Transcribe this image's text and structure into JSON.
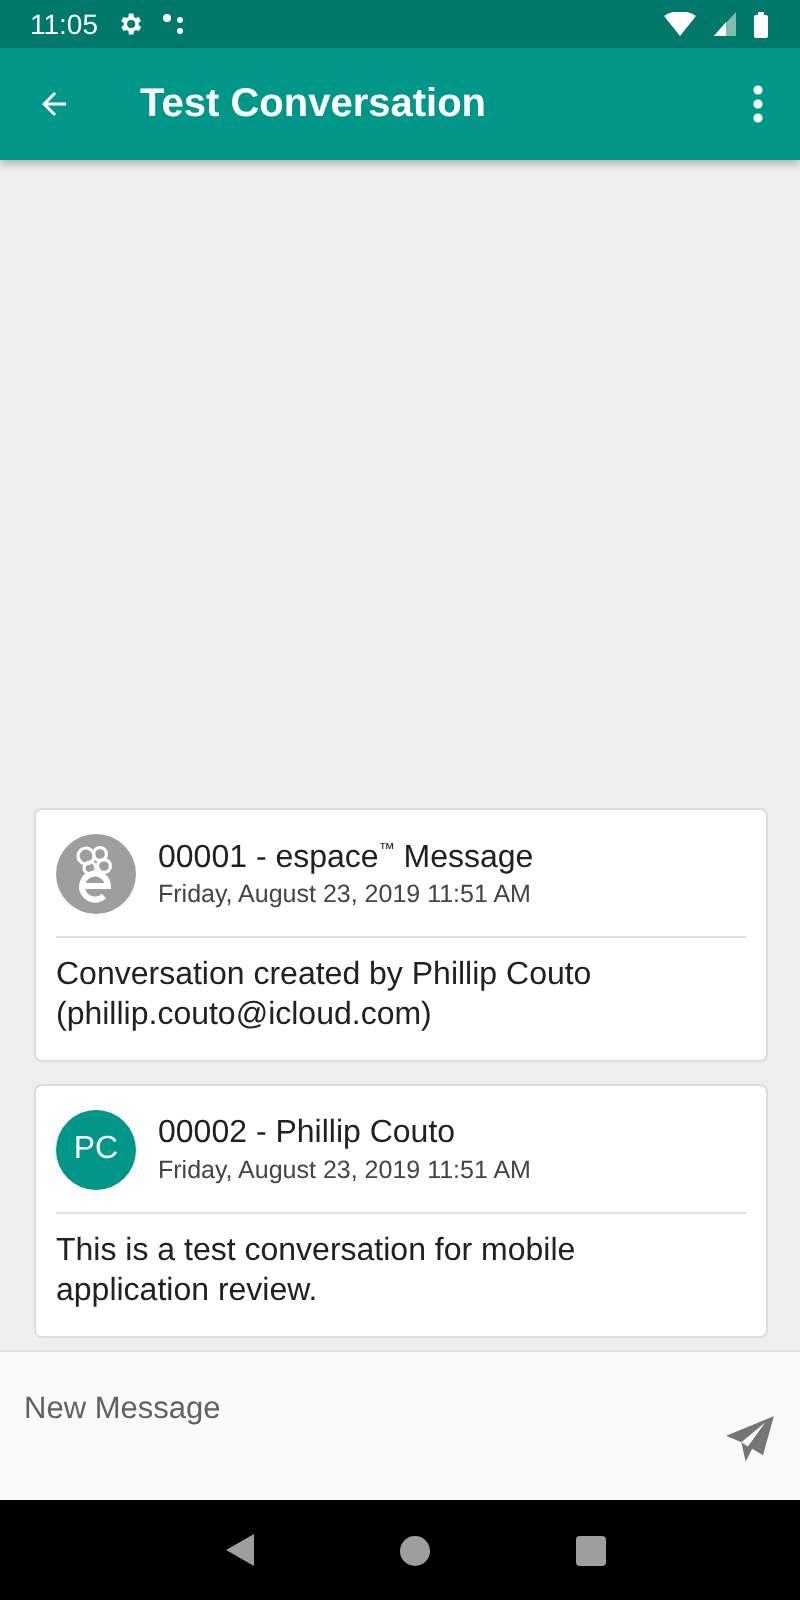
{
  "status_bar": {
    "time": "11:05"
  },
  "app_bar": {
    "title": "Test Conversation"
  },
  "messages": [
    {
      "avatar": {
        "kind": "logo"
      },
      "title": "00001 - espace$^{™}$ Message",
      "date": "Friday, August 23, 2019 11:51 AM",
      "body": "Conversation created by Phillip Couto (phillip.couto@icloud.com)"
    },
    {
      "avatar": {
        "kind": "initials",
        "text": "PC"
      },
      "title": "00002 - Phillip Couto",
      "date": "Friday, August 23, 2019 11:51 AM",
      "body": "This is a test conversation for mobile application review."
    }
  ],
  "composer": {
    "placeholder": "New Message"
  }
}
